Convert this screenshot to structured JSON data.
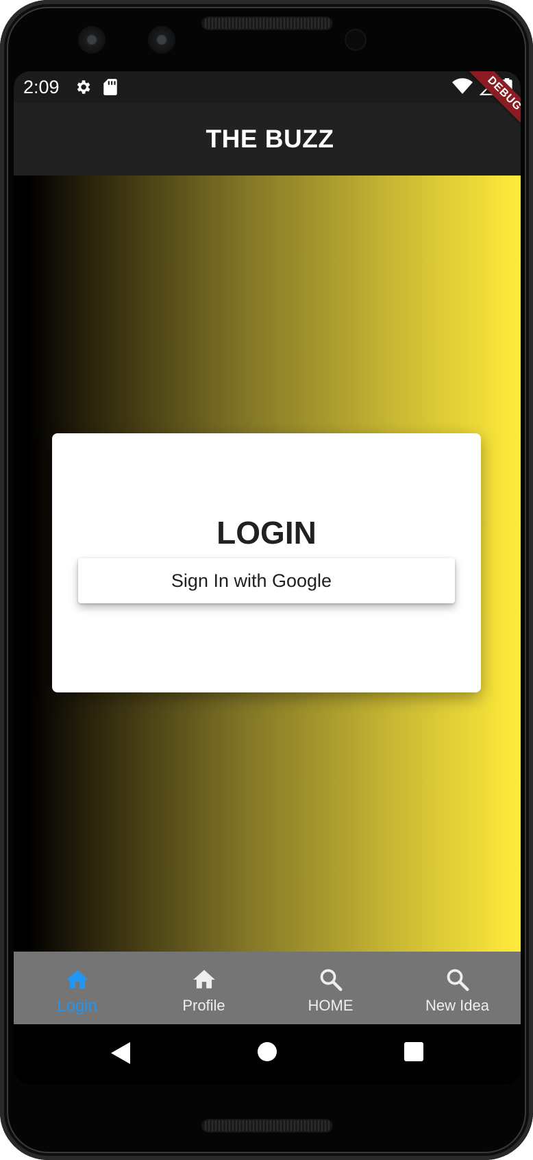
{
  "status_bar": {
    "time": "2:09",
    "icons": [
      "gear-icon",
      "sd-card-icon",
      "wifi-icon",
      "signal-icon",
      "battery-icon"
    ]
  },
  "debug_banner": "DEBUG",
  "app_bar": {
    "title": "THE BUZZ"
  },
  "login_card": {
    "title": "LOGIN",
    "google_button_label": "Sign In with Google"
  },
  "bottom_nav": {
    "items": [
      {
        "label": "Login",
        "icon": "home-icon",
        "active": true
      },
      {
        "label": "Profile",
        "icon": "home-icon",
        "active": false
      },
      {
        "label": "HOME",
        "icon": "search-icon",
        "active": false
      },
      {
        "label": "New Idea",
        "icon": "search-icon",
        "active": false
      }
    ]
  },
  "system_nav": [
    "back-icon",
    "home-circle-icon",
    "recents-icon"
  ],
  "colors": {
    "active": "#2196f3",
    "app_bar": "#212121",
    "bottom_nav": "#757575",
    "gradient_end": "#ffeb3b",
    "debug_ribbon": "#8b1c23"
  }
}
